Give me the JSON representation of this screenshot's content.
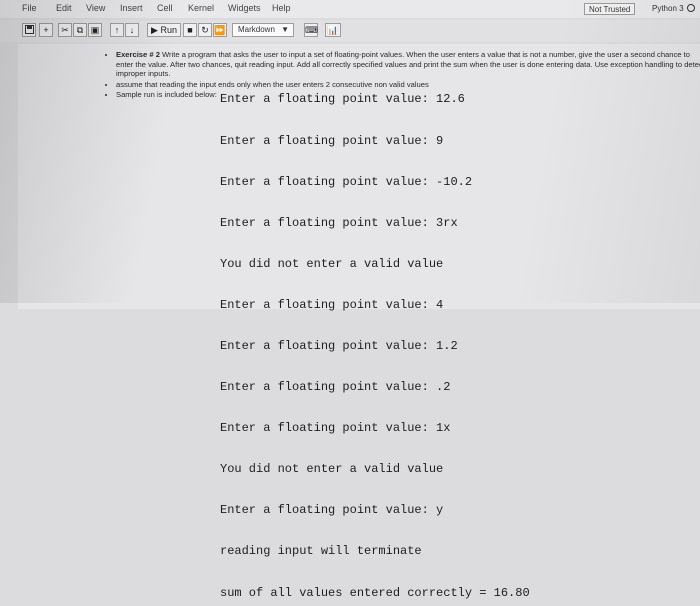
{
  "menubar": {
    "items": [
      "File",
      "Edit",
      "View",
      "Insert",
      "Cell",
      "Kernel",
      "Widgets",
      "Help"
    ],
    "trust_label": "Not Trusted",
    "kernel_label": "Python 3"
  },
  "toolbar": {
    "run_label": "Run",
    "cell_type": "Markdown"
  },
  "markdown": {
    "bullets": [
      {
        "bold": "Exercise # 2",
        "text": " Write a program that asks the user to input a set of floating-point values. When the user enters a value that is not a number, give the user a second chance to enter the value. After two chances, quit reading input. Add all correctly specified values and print the sum when the user is done entering data. Use exception handling to detect improper inputs."
      },
      {
        "bold": "",
        "text": "assume that reading the input ends only when the user enters 2 consecutive non valid values"
      },
      {
        "bold": "",
        "text": "Sample run is included below:"
      }
    ]
  },
  "sample_run": [
    "Enter a floating point value: 12.6",
    "Enter a floating point value: 9",
    "Enter a floating point value: -10.2",
    "Enter a floating point value: 3rx",
    "You did not enter a valid value",
    "Enter a floating point value: 4",
    "Enter a floating point value: 1.2",
    "Enter a floating point value: .2",
    "Enter a floating point value: 1x",
    "You did not enter a valid value",
    "Enter a floating point value: y",
    "reading input will terminate",
    "sum of all values entered correctly = 16.80"
  ]
}
